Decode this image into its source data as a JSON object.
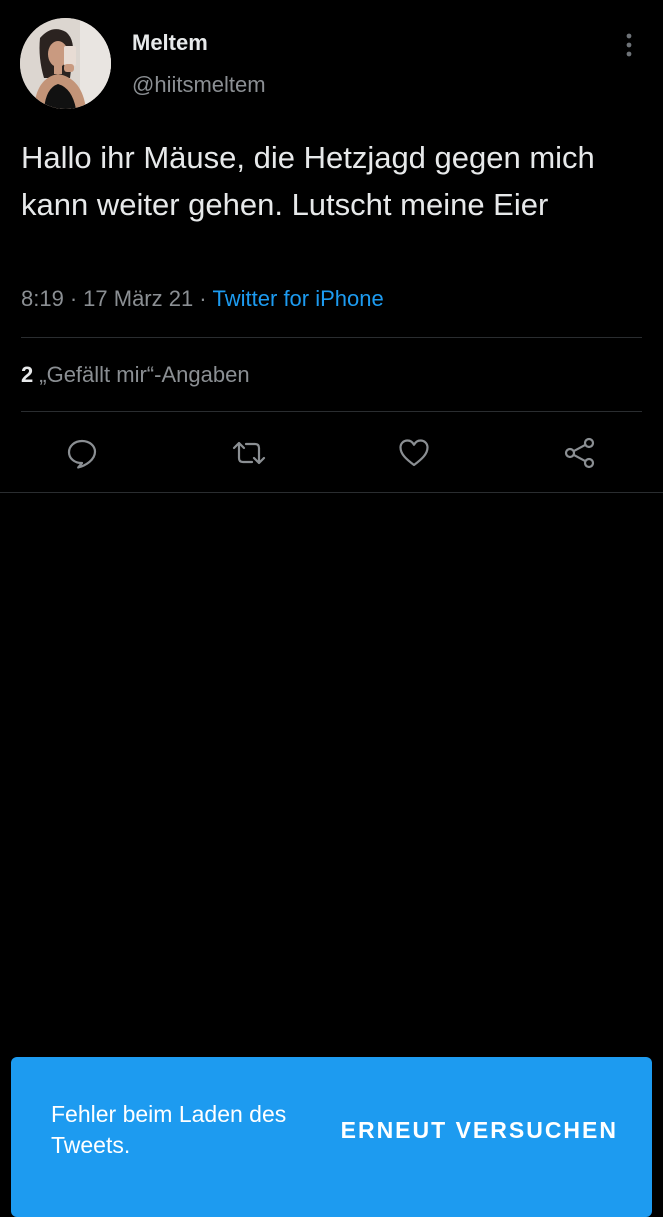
{
  "tweet": {
    "author": {
      "display_name": "Meltem",
      "handle": "@hiitsmeltem"
    },
    "text": "Hallo ihr Mäuse, die Hetzjagd gegen mich kann weiter gehen. Lutscht meine Eier",
    "time": "8:19",
    "separator": "·",
    "date": "17 März 21",
    "source": "Twitter for iPhone",
    "likes": {
      "count": "2",
      "label": "„Gefällt mir“-Angaben"
    },
    "actions": {
      "reply_icon": "reply-icon",
      "retweet_icon": "retweet-icon",
      "like_icon": "heart-icon",
      "share_icon": "share-icon"
    },
    "more_icon": "more-vertical-icon"
  },
  "snackbar": {
    "message": "Fehler beim Laden des Tweets.",
    "action_label": "ERNEUT VERSUCHEN"
  },
  "colors": {
    "background": "#000000",
    "text_primary": "#e7e9ea",
    "text_secondary": "#8b8f93",
    "accent": "#1d9bf0",
    "divider": "#2a2d30"
  }
}
